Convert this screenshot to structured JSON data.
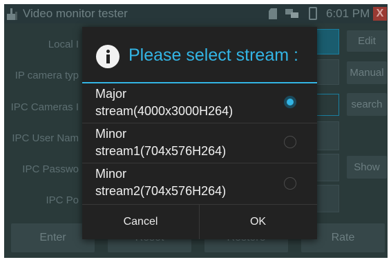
{
  "status_bar": {
    "app_title": "Video monitor tester",
    "time": "6:01 PM",
    "close_label": "X"
  },
  "form": {
    "labels": [
      "Local I",
      "IP camera typ",
      "IPC Cameras I",
      "IPC User Nam",
      "IPC Passwo",
      "IPC Po"
    ],
    "side_buttons": {
      "edit": "Edit",
      "manual": "Manual",
      "search": "search",
      "show": "Show"
    },
    "bottom_buttons": {
      "enter": "Enter",
      "reset": "Reset",
      "restore": "Restore",
      "rate": "Rate"
    }
  },
  "dialog": {
    "title": "Please select stream :",
    "options": [
      {
        "line1": "Major",
        "line2": "stream(4000x3000H264)",
        "selected": true
      },
      {
        "line1": "Minor",
        "line2": "stream1(704x576H264)",
        "selected": false
      },
      {
        "line1": "Minor",
        "line2": "stream2(704x576H264)",
        "selected": false
      }
    ],
    "cancel_label": "Cancel",
    "ok_label": "OK"
  },
  "colors": {
    "accent": "#33b5e5",
    "dialog_bg": "#222222",
    "screen_bg": "#2a3a3a"
  }
}
